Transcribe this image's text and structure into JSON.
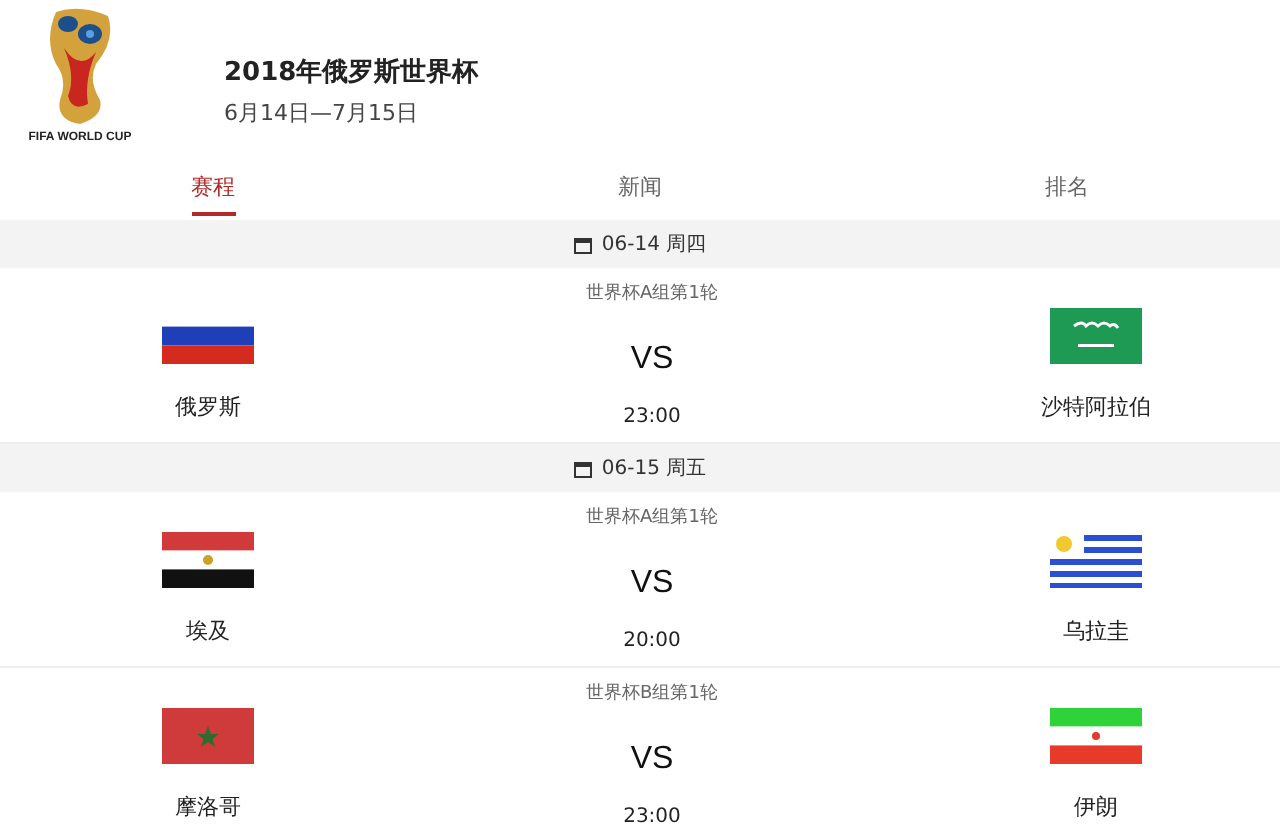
{
  "header": {
    "logo_caption": "FIFA WORLD CUP",
    "title": "2018年俄罗斯世界杯",
    "dates": "6月14日—7月15日"
  },
  "tabs": [
    {
      "label": "赛程",
      "selected": true
    },
    {
      "label": "新闻",
      "selected": false
    },
    {
      "label": "排名",
      "selected": false
    }
  ],
  "days": [
    {
      "date": "06-14 周四",
      "matches": [
        {
          "stage": "世界杯A组第1轮",
          "vs": "VS",
          "time": "23:00",
          "home": {
            "name": "俄罗斯",
            "kind": "ru"
          },
          "away": {
            "name": "沙特阿拉伯",
            "kind": "sa"
          }
        }
      ]
    },
    {
      "date": "06-15 周五",
      "matches": [
        {
          "stage": "世界杯A组第1轮",
          "vs": "VS",
          "time": "20:00",
          "home": {
            "name": "埃及",
            "kind": "eg"
          },
          "away": {
            "name": "乌拉圭",
            "kind": "uy"
          }
        },
        {
          "stage": "世界杯B组第1轮",
          "vs": "VS",
          "time": "23:00",
          "home": {
            "name": "摩洛哥",
            "kind": "ma"
          },
          "away": {
            "name": "伊朗",
            "kind": "ir"
          }
        }
      ]
    }
  ]
}
